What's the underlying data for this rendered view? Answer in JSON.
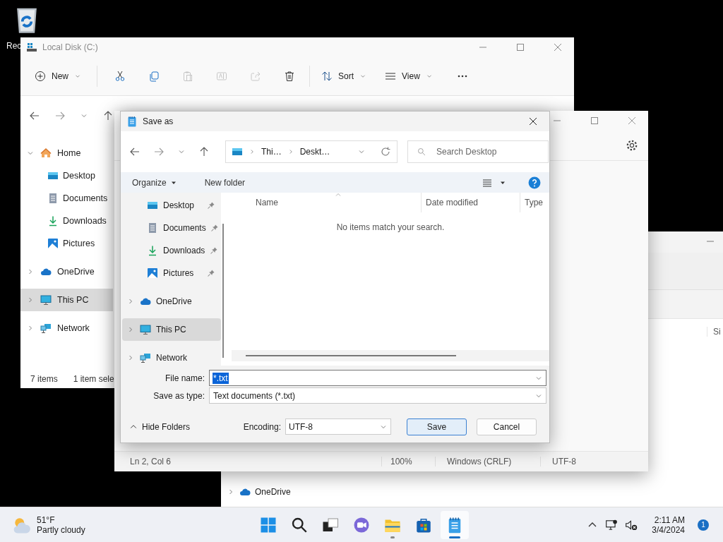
{
  "desktop": {
    "icons": [
      {
        "label": "Rec"
      }
    ]
  },
  "explorer": {
    "title": "Local Disk (C:)",
    "toolbar": [
      {
        "kind": "new",
        "label": "New",
        "disabled": false
      },
      {
        "kind": "cut",
        "disabled": false
      },
      {
        "kind": "copy",
        "disabled": false
      },
      {
        "kind": "paste",
        "disabled": true
      },
      {
        "kind": "rename",
        "disabled": true
      },
      {
        "kind": "share",
        "disabled": true
      },
      {
        "kind": "delete",
        "disabled": false
      },
      {
        "kind": "sort",
        "label": "Sort",
        "disabled": false
      },
      {
        "kind": "view",
        "label": "View",
        "disabled": false
      },
      {
        "kind": "more",
        "disabled": false
      }
    ],
    "nav": [
      {
        "label": "Home",
        "kind": "home",
        "expanded": true,
        "selected": false,
        "children": [
          {
            "label": "Desktop",
            "kind": "desktop",
            "selected": false
          },
          {
            "label": "Documents",
            "kind": "documents",
            "selected": false
          },
          {
            "label": "Downloads",
            "kind": "downloads",
            "selected": false
          },
          {
            "label": "Pictures",
            "kind": "pictures",
            "selected": false
          }
        ]
      },
      {
        "label": "OneDrive",
        "kind": "cloud",
        "expanded": false,
        "selected": false
      },
      {
        "label": "This PC",
        "kind": "pc",
        "expanded": false,
        "selected": true
      },
      {
        "label": "Network",
        "kind": "network",
        "expanded": false,
        "selected": false
      }
    ],
    "status": [
      "7 items",
      "1 item sele"
    ]
  },
  "notepad": {
    "status": [
      "Ln 2, Col 6",
      "100%",
      "Windows (CRLF)",
      "UTF-8"
    ]
  },
  "back_window": {
    "nav": [
      {
        "label": "OneDrive",
        "kind": "cloud"
      }
    ],
    "columns": [
      "Si"
    ]
  },
  "dialog": {
    "title": "Save as",
    "path": [
      "Thi…",
      "Deskt…"
    ],
    "search": {
      "placeholder": "Search Desktop"
    },
    "commands": [
      {
        "label": "Organize",
        "dropdown": true
      },
      {
        "label": "New folder",
        "dropdown": false
      }
    ],
    "nav": [
      {
        "label": "Desktop",
        "kind": "desktop",
        "pinned": true,
        "selected": false
      },
      {
        "label": "Documents",
        "kind": "documents",
        "pinned": true,
        "selected": false
      },
      {
        "label": "Downloads",
        "kind": "downloads",
        "pinned": true,
        "selected": false
      },
      {
        "label": "Pictures",
        "kind": "pictures",
        "pinned": true,
        "selected": false
      },
      {
        "label": "OneDrive",
        "kind": "cloud",
        "pinned": false,
        "selected": false
      },
      {
        "label": "This PC",
        "kind": "pc",
        "pinned": false,
        "selected": true
      },
      {
        "label": "Network",
        "kind": "network",
        "pinned": false,
        "selected": false
      }
    ],
    "columns": [
      "Name",
      "Date modified",
      "Type"
    ],
    "empty_message": "No items match your search.",
    "fields": [
      {
        "label": "File name:",
        "value": "*.txt",
        "text_selected": true
      },
      {
        "label": "Save as type:",
        "value": "Text documents (*.txt)",
        "text_selected": false
      }
    ],
    "hide_folders": "Hide Folders",
    "encoding": {
      "label": "Encoding:",
      "value": "UTF-8"
    },
    "buttons": [
      {
        "label": "Save",
        "default": true
      },
      {
        "label": "Cancel",
        "default": false
      }
    ]
  },
  "taskbar": {
    "weather": {
      "temperature": "51°F",
      "condition": "Partly cloudy"
    },
    "apps": [
      {
        "kind": "start",
        "running": false,
        "active": false
      },
      {
        "kind": "search",
        "running": false,
        "active": false
      },
      {
        "kind": "taskview",
        "running": false,
        "active": false
      },
      {
        "kind": "chat",
        "running": false,
        "active": false
      },
      {
        "kind": "folder",
        "running": true,
        "active": false
      },
      {
        "kind": "store",
        "running": false,
        "active": false
      },
      {
        "kind": "notepad",
        "running": true,
        "active": true
      }
    ],
    "clock": {
      "time": "2:11 AM",
      "date": "3/4/2024"
    },
    "notifications": "1"
  }
}
